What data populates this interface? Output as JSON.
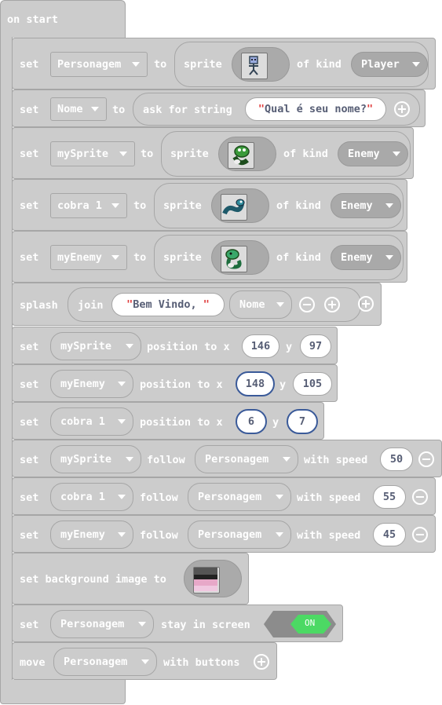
{
  "hat": {
    "label": "on start"
  },
  "b1": {
    "kw": "set",
    "var": "Personagem",
    "to": "to",
    "sprite": "sprite",
    "of_kind": "of kind",
    "kind": "Player"
  },
  "b2": {
    "kw": "set",
    "var": "Nome",
    "to": "to",
    "ask": "ask for string",
    "prompt": "Qual é seu nome?"
  },
  "b3": {
    "kw": "set",
    "var": "mySprite",
    "to": "to",
    "sprite": "sprite",
    "of_kind": "of kind",
    "kind": "Enemy"
  },
  "b4": {
    "kw": "set",
    "var": "cobra 1",
    "to": "to",
    "sprite": "sprite",
    "of_kind": "of kind",
    "kind": "Enemy"
  },
  "b5": {
    "kw": "set",
    "var": "myEnemy",
    "to": "to",
    "sprite": "sprite",
    "of_kind": "of kind",
    "kind": "Enemy"
  },
  "b6": {
    "kw": "splash",
    "join": "join",
    "text": "Bem Vindo, ",
    "var": "Nome"
  },
  "b7": {
    "kw": "set",
    "var": "mySprite",
    "pos": "position to x",
    "x": "146",
    "y_label": "y",
    "y": "97"
  },
  "b8": {
    "kw": "set",
    "var": "myEnemy",
    "pos": "position to x",
    "x": "148",
    "y_label": "y",
    "y": "105"
  },
  "b9": {
    "kw": "set",
    "var": "cobra 1",
    "pos": "position to x",
    "x": "6",
    "y_label": "y",
    "y": "7"
  },
  "b10": {
    "kw": "set",
    "var": "mySprite",
    "follow": "follow",
    "target": "Personagem",
    "with_speed": "with speed",
    "speed": "50"
  },
  "b11": {
    "kw": "set",
    "var": "cobra 1",
    "follow": "follow",
    "target": "Personagem",
    "with_speed": "with speed",
    "speed": "55"
  },
  "b12": {
    "kw": "set",
    "var": "myEnemy",
    "follow": "follow",
    "target": "Personagem",
    "with_speed": "with speed",
    "speed": "45"
  },
  "b13": {
    "label": "set background image to"
  },
  "b14": {
    "kw": "set",
    "var": "Personagem",
    "stay": "stay in screen",
    "toggle": "ON"
  },
  "b15": {
    "kw": "move",
    "var": "Personagem",
    "with_buttons": "with buttons"
  },
  "colors": {
    "block": "#cccccc",
    "border": "#a6a6a6",
    "toggle_on": "#4cd964",
    "field_text": "#575e75",
    "quote": "#e04040"
  }
}
